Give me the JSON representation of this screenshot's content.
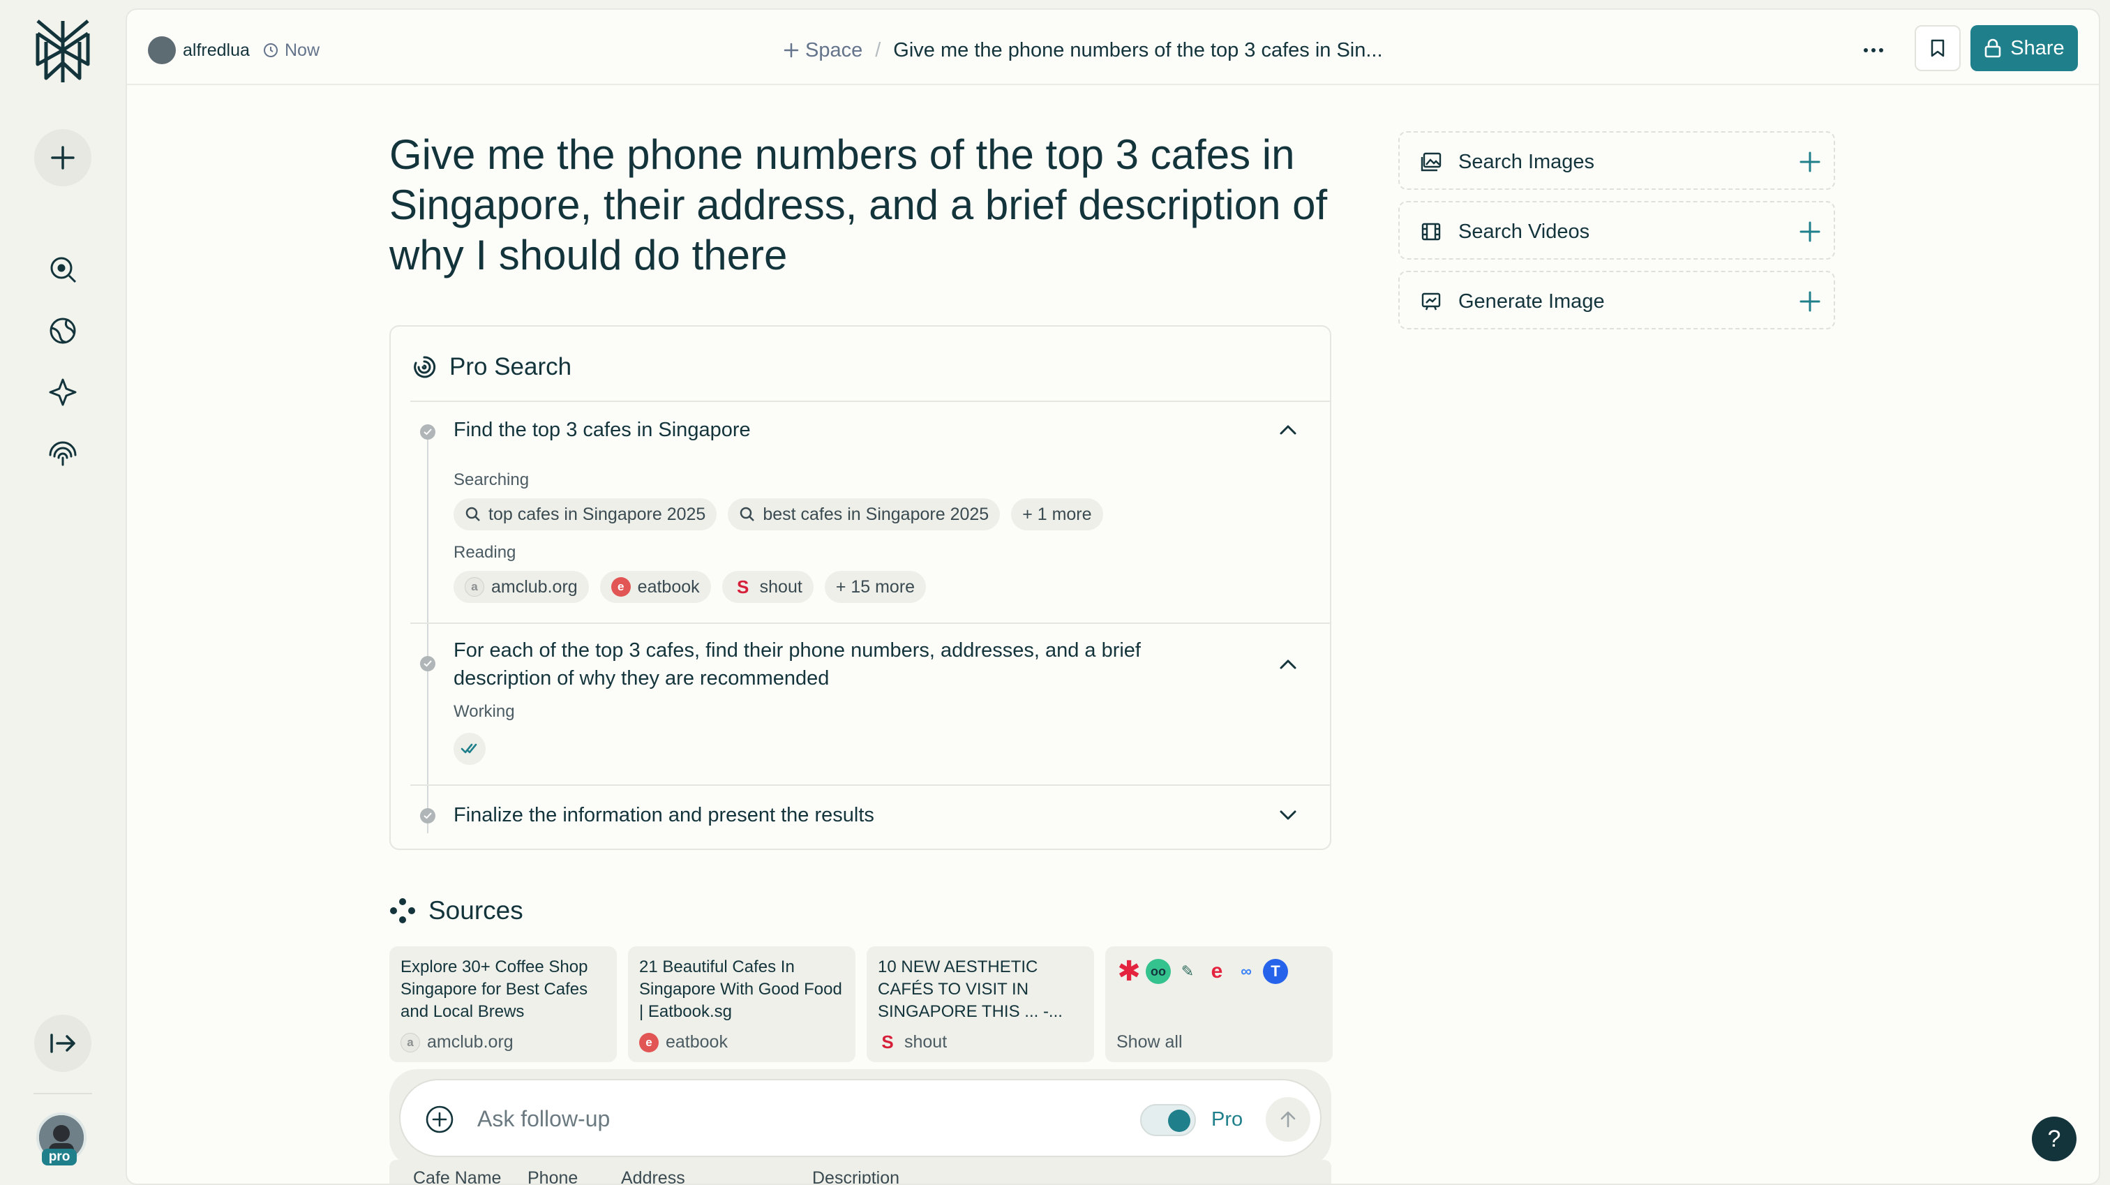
{
  "header": {
    "username": "alfredlua",
    "time": "Now",
    "space_label": "Space",
    "thread_title": "Give me the phone numbers of the top 3 cafes in Sin...",
    "share_label": "Share"
  },
  "query": "Give me the phone numbers of the top 3 cafes in Singapore, their address, and a brief description of why I should do there",
  "pro_search": {
    "title": "Pro Search",
    "steps": [
      {
        "title": "Find the top 3 cafes in Singapore",
        "searching_label": "Searching",
        "queries": [
          "top cafes in Singapore 2025",
          "best cafes in Singapore 2025",
          "+ 1 more"
        ],
        "reading_label": "Reading",
        "sources": [
          "amclub.org",
          "eatbook",
          "shout",
          "+ 15 more"
        ]
      },
      {
        "title": "For each of the top 3 cafes, find their phone numbers, addresses, and a brief description of why they are recommended",
        "working_label": "Working"
      },
      {
        "title": "Finalize the information and present the results"
      }
    ]
  },
  "sources": {
    "title": "Sources",
    "cards": [
      {
        "title": "Explore 30+ Coffee Shop Singapore for Best Cafes and Local Brews",
        "site": "amclub.org"
      },
      {
        "title": "21 Beautiful Cafes In Singapore With Good Food | Eatbook.sg",
        "site": "eatbook"
      },
      {
        "title": "10 NEW AESTHETIC CAFÉS TO VISIT IN SINGAPORE THIS ... -...",
        "site": "shout"
      }
    ],
    "show_all": "Show all"
  },
  "followup": {
    "placeholder": "Ask follow-up",
    "pro_label": "Pro"
  },
  "table": {
    "headers": [
      "Cafe Name",
      "Phone",
      "Address",
      "Description"
    ]
  },
  "side_actions": [
    {
      "label": "Search Images",
      "icon": "image-icon"
    },
    {
      "label": "Search Videos",
      "icon": "film-icon"
    },
    {
      "label": "Generate Image",
      "icon": "generate-image-icon"
    }
  ],
  "avatar_badge": "pro",
  "help_label": "?",
  "colors": {
    "accent": "#1f7f8b",
    "text": "#13343b",
    "background": "#fcfcf9",
    "rail": "#f3f3ee"
  }
}
